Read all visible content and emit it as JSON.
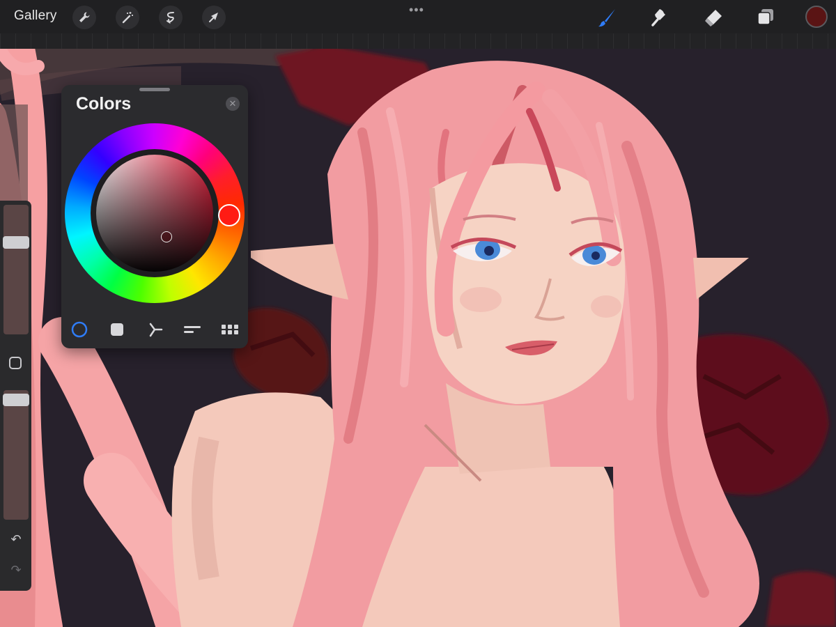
{
  "toolbar": {
    "gallery_label": "Gallery",
    "left_tools": [
      "wrench-icon",
      "magic-wand-icon",
      "selection-icon",
      "transform-arrow-icon"
    ],
    "more_glyph": "•••",
    "right_tools": [
      "brush-icon",
      "smudge-icon",
      "eraser-icon",
      "layers-icon"
    ],
    "active_tool": "brush",
    "current_color": "#5a1414",
    "accent_color": "#2f7cf6"
  },
  "sidebar": {
    "brush_size_level": 0.27,
    "opacity_level": 0.03,
    "modify_button": "square",
    "undo_glyph": "↶",
    "redo_glyph": "↷"
  },
  "colors_panel": {
    "title": "Colors",
    "close_glyph": "✕",
    "hue_color": "#ff1b14",
    "modes": [
      "disc-mode-icon",
      "classic-mode-icon",
      "harmony-mode-icon",
      "value-mode-icon",
      "palettes-mode-icon"
    ],
    "active_mode": "disc"
  }
}
